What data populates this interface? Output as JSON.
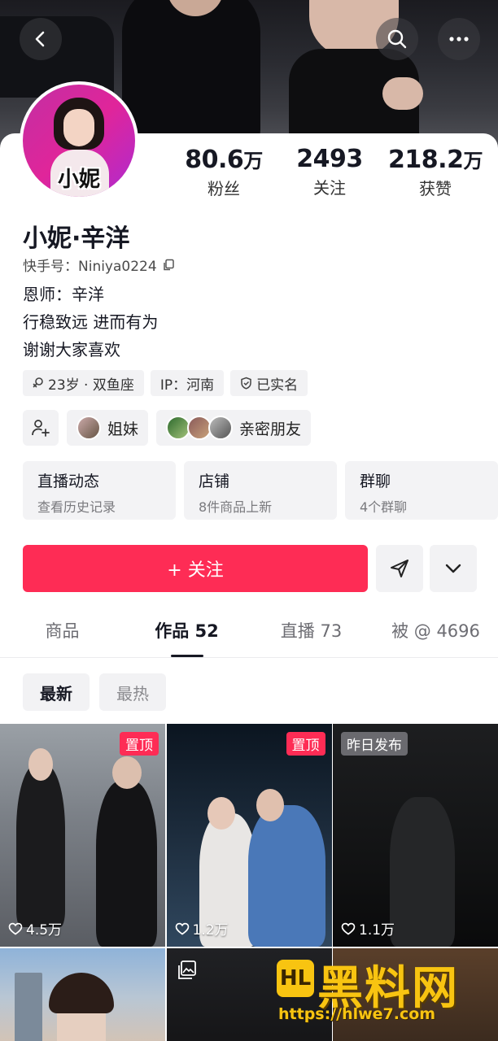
{
  "profile": {
    "avatar_text": "小妮",
    "nickname": "小妮·辛洋",
    "kuaishou_id": "快手号：Niniya0224",
    "bio": [
      "恩师：辛洋",
      "行稳致远 进而有为",
      "谢谢大家喜欢"
    ]
  },
  "stats": [
    {
      "num": "80.6",
      "unit": "万",
      "label": "粉丝"
    },
    {
      "num": "2493",
      "unit": "",
      "label": "关注"
    },
    {
      "num": "218.2",
      "unit": "万",
      "label": "获赞"
    }
  ],
  "tags": {
    "age": "23岁 · 双鱼座",
    "ip": "IP：河南",
    "verified": "已实名"
  },
  "friends": {
    "sisters": "姐妹",
    "close": "亲密朋友"
  },
  "quick": [
    {
      "title": "直播动态",
      "sub": "查看历史记录"
    },
    {
      "title": "店铺",
      "sub": "8件商品上新"
    },
    {
      "title": "群聊",
      "sub": "4个群聊"
    }
  ],
  "follow_label": "+ 关注",
  "tabs": [
    {
      "label": "商品"
    },
    {
      "label": "作品 52"
    },
    {
      "label": "直播 73"
    },
    {
      "label": "被 @ 4696"
    }
  ],
  "sorts": {
    "newest": "最新",
    "hottest": "最热"
  },
  "videos": [
    {
      "badge": "置顶",
      "likes": "4.5万"
    },
    {
      "badge": "置顶",
      "likes": "1.2万"
    },
    {
      "badge": "昨日发布",
      "likes": "1.1万"
    }
  ],
  "watermark": {
    "title": "黑料网",
    "logo": "HL",
    "url": "https://hlwe7.com"
  },
  "colors": {
    "accent": "#fe2c55",
    "watermark": "#f8c411"
  }
}
